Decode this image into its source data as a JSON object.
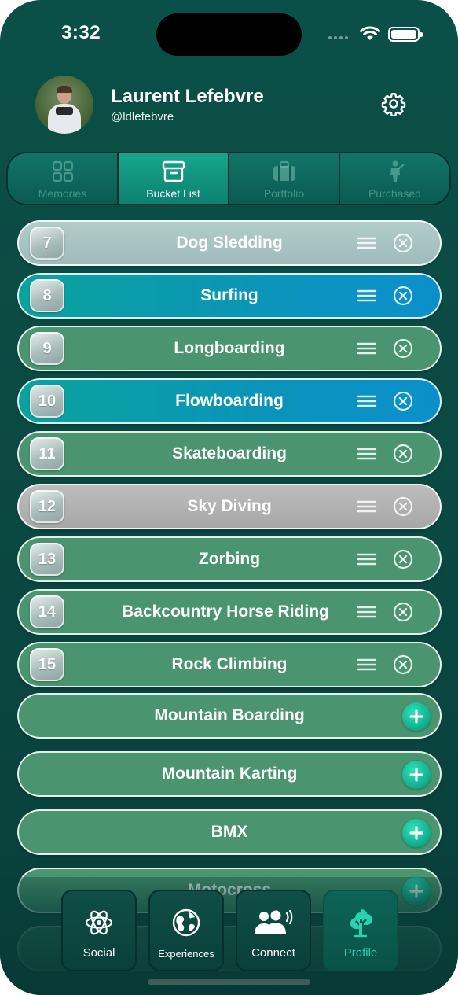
{
  "status_bar": {
    "time": "3:32"
  },
  "profile": {
    "name": "Laurent Lefebvre",
    "handle": "@ldlefebvre"
  },
  "tabs": [
    {
      "label": "Memories",
      "icon": "grid-icon",
      "active": false
    },
    {
      "label": "Bucket List",
      "icon": "archive-box-icon",
      "active": true
    },
    {
      "label": "Portfolio",
      "icon": "suitcase-icon",
      "active": false
    },
    {
      "label": "Purchased",
      "icon": "person-icon",
      "active": false
    }
  ],
  "bucket_list": [
    {
      "number": "7",
      "title": "Dog Sledding",
      "color": "#a8c4c3"
    },
    {
      "number": "8",
      "title": "Surfing",
      "color": "#0a95b8"
    },
    {
      "number": "9",
      "title": "Longboarding",
      "color": "#4a9470"
    },
    {
      "number": "10",
      "title": "Flowboarding",
      "color": "#0a95b8"
    },
    {
      "number": "11",
      "title": "Skateboarding",
      "color": "#4a9470"
    },
    {
      "number": "12",
      "title": "Sky Diving",
      "color": "#b2b2b2"
    },
    {
      "number": "13",
      "title": "Zorbing",
      "color": "#4a9470"
    },
    {
      "number": "14",
      "title": "Backcountry Horse Riding",
      "color": "#4a9470"
    },
    {
      "number": "15",
      "title": "Rock Climbing",
      "color": "#4a9470"
    }
  ],
  "suggestions": [
    {
      "title": "Mountain Boarding"
    },
    {
      "title": "Mountain Karting"
    },
    {
      "title": "BMX"
    },
    {
      "title": "Motocross"
    }
  ],
  "bottom_nav": [
    {
      "label": "Social",
      "icon": "atom-icon",
      "active": false
    },
    {
      "label": "Experiences",
      "icon": "globe-icon",
      "active": false
    },
    {
      "label": "Connect",
      "icon": "people-icon",
      "active": false
    },
    {
      "label": "Profile",
      "icon": "tree-icon",
      "active": true
    }
  ]
}
